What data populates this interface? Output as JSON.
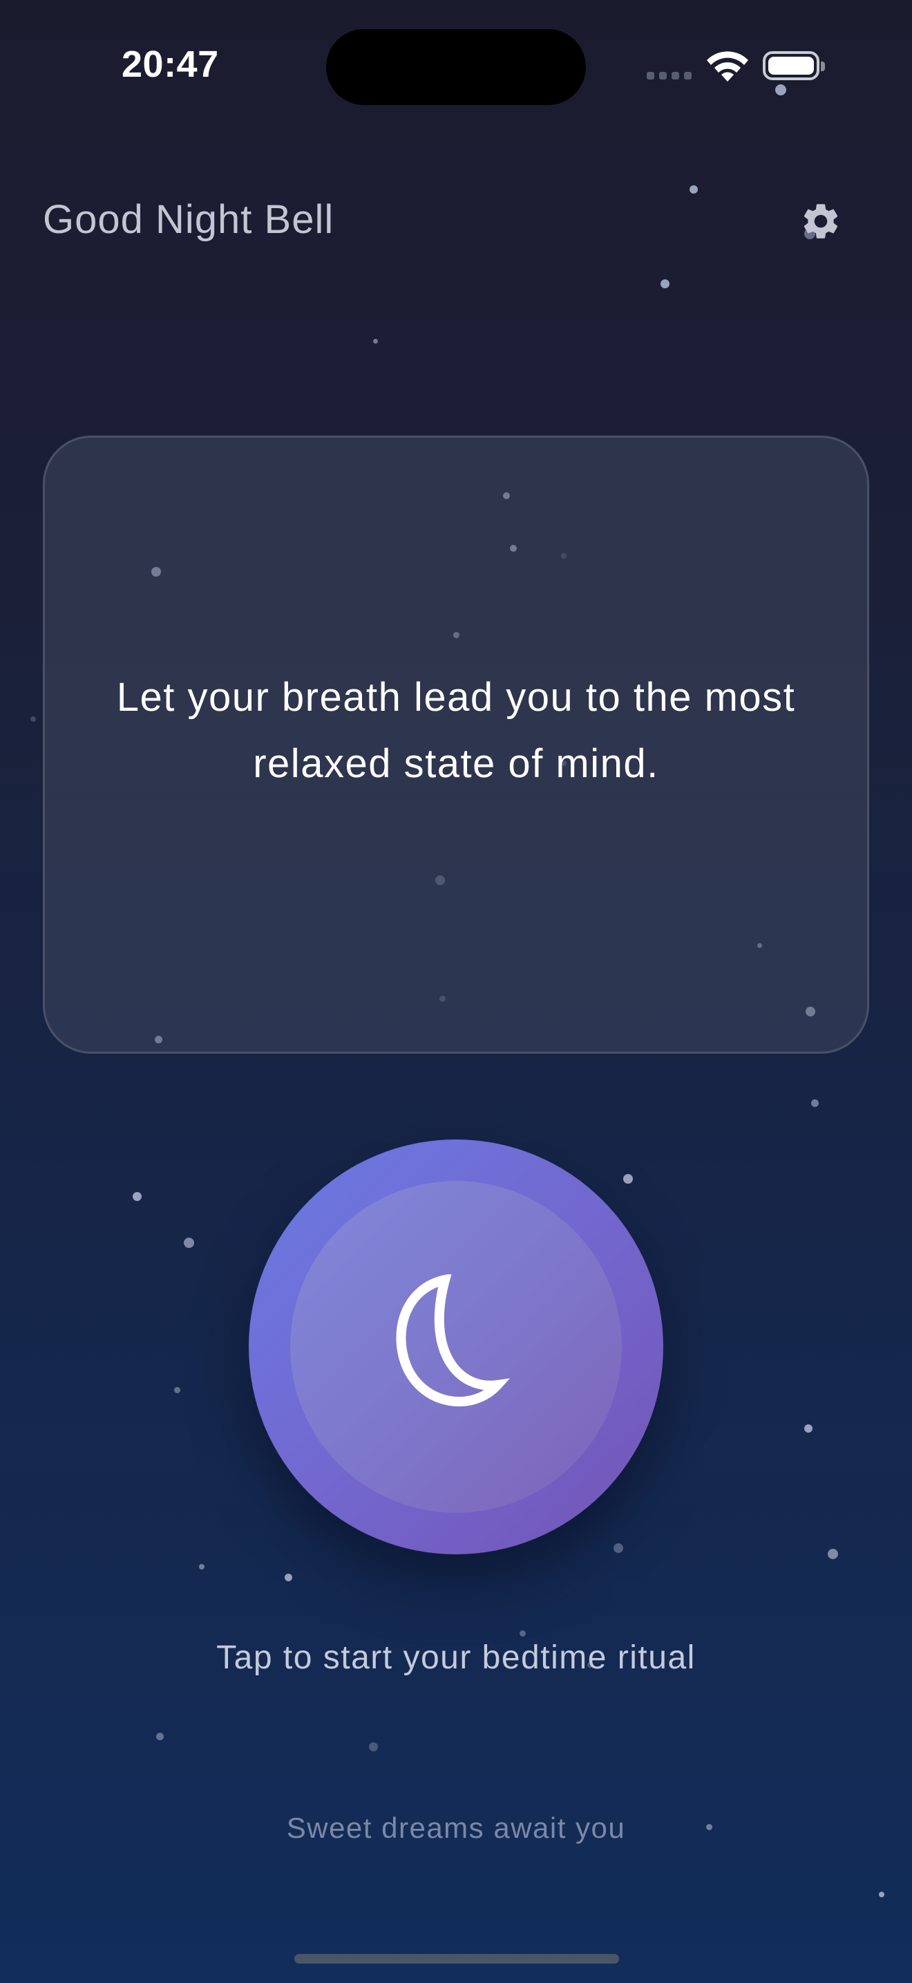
{
  "status_bar": {
    "time": "20:47",
    "icons": [
      "cellular-signal-icon",
      "wifi-icon",
      "battery-icon"
    ]
  },
  "header": {
    "title": "Good Night Bell",
    "settings_icon": "gear-icon"
  },
  "card": {
    "message": "Let your breath lead you to the most relaxed state of mind."
  },
  "main_button": {
    "icon": "moon-icon"
  },
  "hint": "Tap to start your bedtime ritual",
  "footer": "Sweet dreams await you",
  "colors": {
    "background_top": "#1b1b2e",
    "background_bottom": "#122d5a",
    "button_gradient_start": "#6a7ae3",
    "button_gradient_end": "#7454b5",
    "title_text": "#c3c6d2"
  }
}
